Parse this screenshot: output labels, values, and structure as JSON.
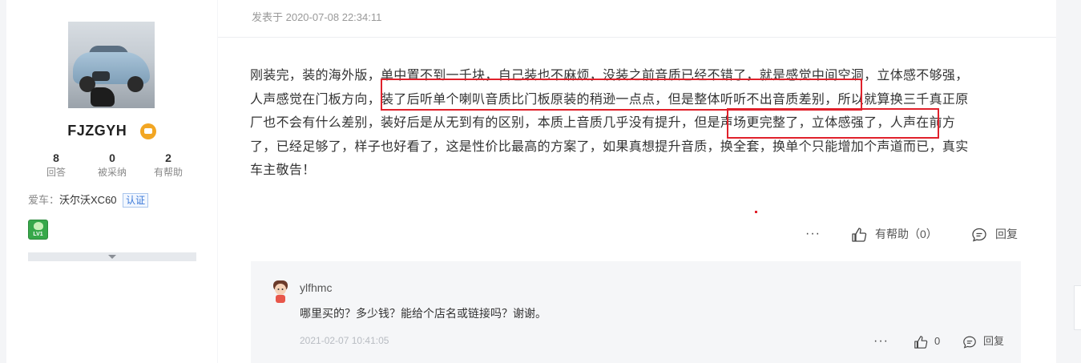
{
  "user": {
    "name": "FJZGYH",
    "stats": [
      {
        "num": "8",
        "label": "回答"
      },
      {
        "num": "0",
        "label": "被采纳"
      },
      {
        "num": "2",
        "label": "有帮助"
      }
    ],
    "car_label": "爱车：",
    "car_value": "沃尔沃XC60",
    "cert": "认证",
    "level": "LV1"
  },
  "post": {
    "time": "发表于 2020-07-08 22:34:11",
    "lines": [
      "刚装完，装的海外版，单中置不到一千块，自己装也不麻烦，没装之前音质已经不错了，就是感觉中间空洞，立体感不够强，",
      "人声感觉在门板方向，装了后听单个喇叭音质比门板原装的稍逊一点点，但是整体听听不出音质差别，所以就算换三千真正原",
      "厂也不会有什么差别，装好后是从无到有的区别，本质上音质几乎没有提升，但是声场更完整了，立体感强了，人声在前方",
      "了，已经足够了，样子也好看了，这是性价比最高的方案了，如果真想提升音质，换全套，换单个只能增加个声道而已，真实",
      "车主敬告！"
    ],
    "more": "···",
    "helpful_label": "有帮助（0）",
    "reply_label": "回复"
  },
  "comment": {
    "user": "ylfhmc",
    "text": "哪里买的？多少钱？能给个店名或链接吗？谢谢。",
    "time": "2021-02-07 10:41:05",
    "more": "···",
    "like_count": "0",
    "reply_label": "回复"
  },
  "colors": {
    "highlight_red": "#e0212b",
    "page_bg": "#f4f5f7",
    "comment_bg": "#f5f6f8"
  }
}
